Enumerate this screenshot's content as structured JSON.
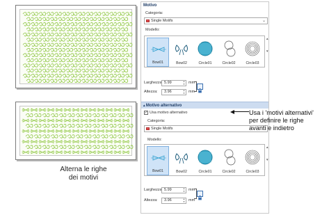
{
  "left_caption": {
    "line1": "Alterna le righe",
    "line2": "dei motivi"
  },
  "callout": {
    "line1": "Usa i 'motivi alternativi'",
    "line2": "per definire le righe",
    "line3": "avanti e indietro"
  },
  "panel": {
    "motivo": {
      "title": "Motivo",
      "category_label": "Categoria:",
      "category_value": "Single Motifs",
      "model_label": "Modello:",
      "thumbnails": [
        "Bow01",
        "Bow02",
        "Circle01",
        "Circle02",
        "Circle03"
      ],
      "selected_index": 0,
      "width_label": "Larghezza:",
      "width_value": "5.99",
      "height_label": "Altezza:",
      "height_value": "3.96",
      "unit": "mm"
    },
    "alt": {
      "title": "Motivo alternativo",
      "checkbox_label": "Usa motivo alternativo",
      "checkbox_checked": true,
      "category_label": "Categoria:",
      "category_value": "Single Motifs",
      "model_label": "Modello:",
      "thumbnails": [
        "Bow01",
        "Bow02",
        "Circle01",
        "Circle02",
        "Circle03"
      ],
      "selected_index": 0,
      "width_label": "Larghezza:",
      "width_value": "5.99",
      "height_label": "Altezza:",
      "height_value": "3.96",
      "unit": "mm"
    }
  },
  "icons": {
    "check": "✓",
    "dropdown": "⌄",
    "scroll_up": "▲",
    "scroll_down": "▼",
    "spin_up": "▲",
    "spin_down": "▼",
    "lock": "lock-icon"
  },
  "colors": {
    "stitch_green": "#8cc63f",
    "stitch_light": "#b8dc80",
    "stitch_blue": "#2f9fd0",
    "section_blue": "#cddcf0"
  }
}
